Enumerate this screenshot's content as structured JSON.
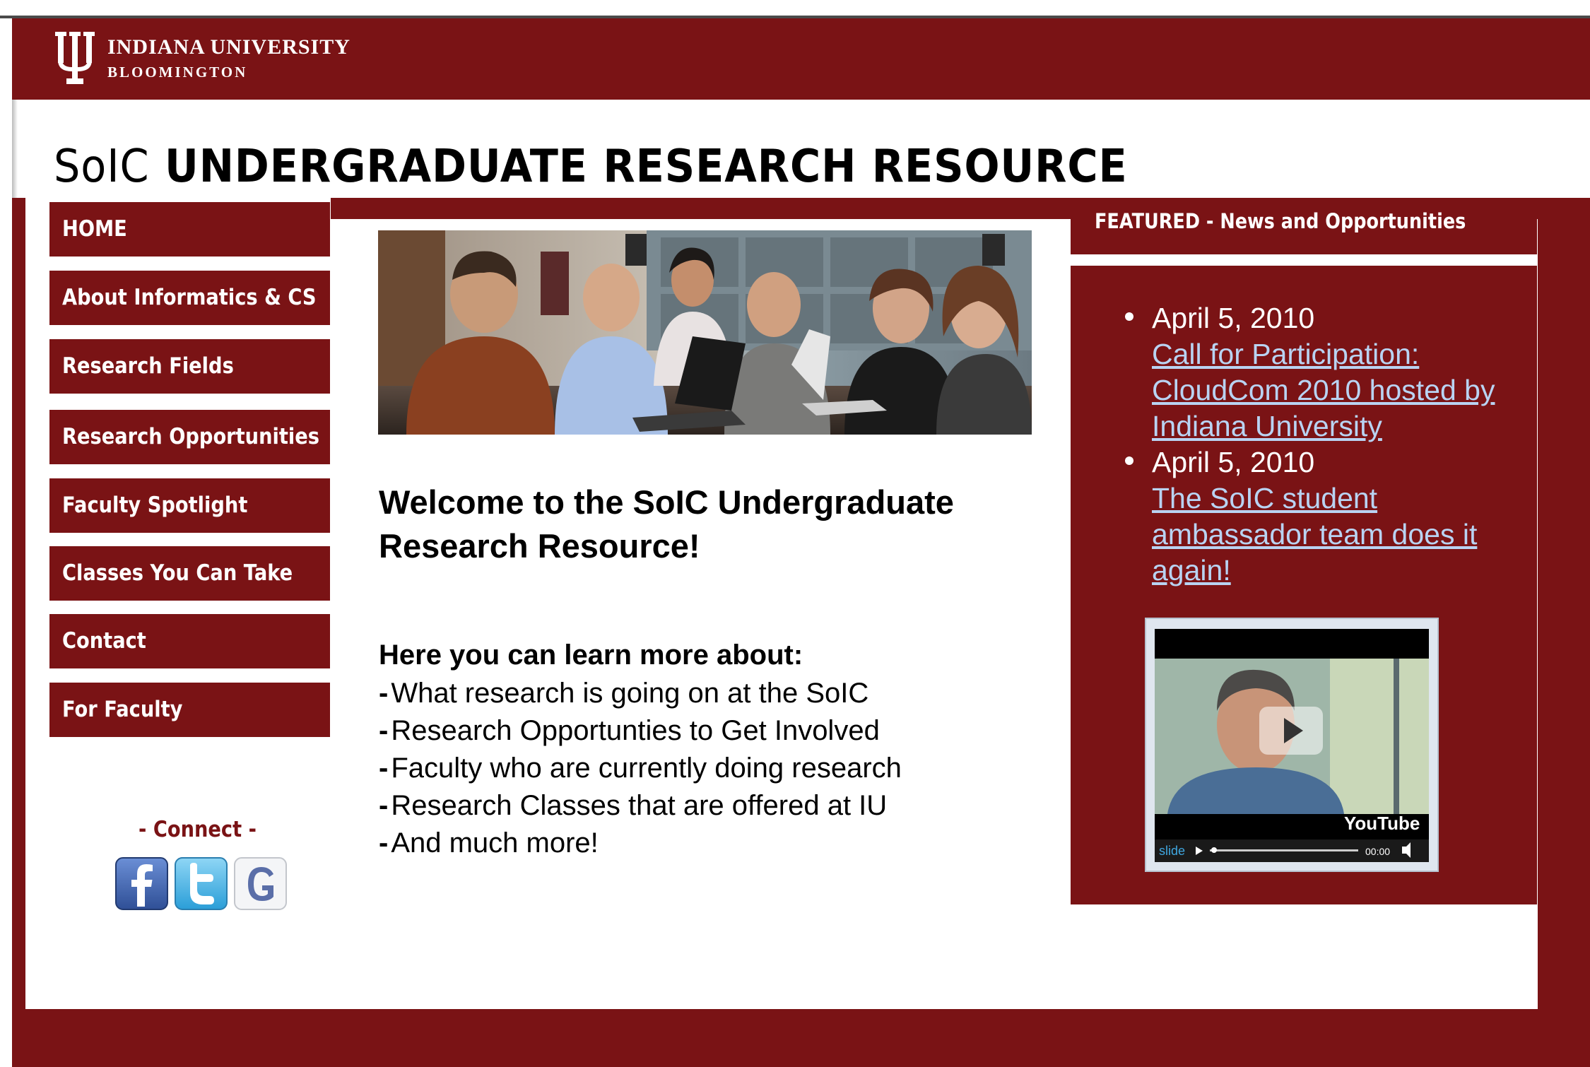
{
  "header": {
    "university": "INDIANA UNIVERSITY",
    "campus": "BLOOMINGTON",
    "site_title_prefix": "SoIC",
    "site_title_main": "UNDERGRADUATE RESEARCH RESOURCE"
  },
  "nav": {
    "items": [
      {
        "label": "HOME"
      },
      {
        "label": "About Informatics & CS"
      },
      {
        "label": "Research Fields"
      },
      {
        "label": "Research Opportunities"
      },
      {
        "label": "Faculty Spotlight"
      },
      {
        "label": "Classes You Can Take"
      },
      {
        "label": "Contact"
      },
      {
        "label": "For Faculty"
      }
    ]
  },
  "connect": {
    "label": "- Connect -",
    "icons": [
      "facebook-icon",
      "twitter-icon",
      "google-icon"
    ]
  },
  "main": {
    "welcome": "Welcome to the SoIC Undergraduate Research Resource!",
    "learn_heading": "Here you can learn more about:",
    "learn_items": [
      "What research is going on at the SoIC",
      "Research Opportunties to Get Involved",
      "Faculty who are currently doing research",
      "Research Classes that are offered at IU",
      "And much more!"
    ]
  },
  "featured": {
    "heading": "FEATURED - News and Opportunities",
    "news": [
      {
        "date": "April 5, 2010",
        "link": "Call for Participation: CloudCom 2010 hosted by Indiana University"
      },
      {
        "date": "April 5, 2010",
        "link": "The SoIC student ambassador team does it again!"
      }
    ],
    "video": {
      "brand": "YouTube",
      "player_logo": "slide",
      "time": "00:00"
    }
  },
  "colors": {
    "maroon": "#7a1315",
    "link": "#b9d3f2"
  }
}
